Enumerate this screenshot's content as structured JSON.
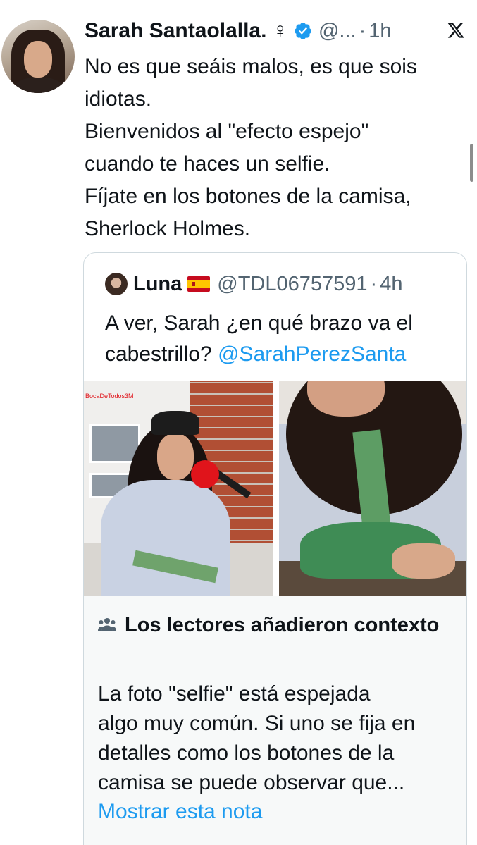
{
  "tweet": {
    "author": {
      "name": "Sarah Santaolalla.",
      "emoji": "♀",
      "handle": "@...",
      "separator": "·",
      "time": "1h",
      "verified": true
    },
    "text_lines": [
      "No es que seáis malos, es que sois",
      "idiotas.",
      "Bienvenidos al \"efecto espejo\"",
      "cuando te haces un selfie.",
      "Fíjate en los botones de la camisa,",
      "Sherlock Holmes."
    ]
  },
  "quote": {
    "author": {
      "name": "Luna",
      "flag": "spain-flag",
      "handle": "@TDL06757591",
      "separator": "·",
      "time": "4h"
    },
    "text_line_1": "A ver, Sarah ¿en qué brazo va el",
    "text_line_2": "cabestrillo?",
    "mention": "@SarahPerezSanta",
    "photo_left_watermark": "BocaDeTodos3M"
  },
  "note": {
    "title": "Los lectores añadieron contexto",
    "body_lines": [
      "La foto \"selfie\" está espejada",
      "algo muy común. Si uno se fija en",
      "detalles como los botones de la",
      "camisa se puede observar que..."
    ],
    "link": "Mostrar esta nota"
  },
  "colors": {
    "text": "#0f1419",
    "secondary": "#536471",
    "link": "#1d9bf0",
    "verified": "#1d9bf0",
    "note_bg": "#f7f9f9",
    "border": "#cfd9de"
  },
  "icons": [
    "verified-badge-icon",
    "x-logo-icon",
    "spain-flag-icon",
    "people-icon"
  ]
}
